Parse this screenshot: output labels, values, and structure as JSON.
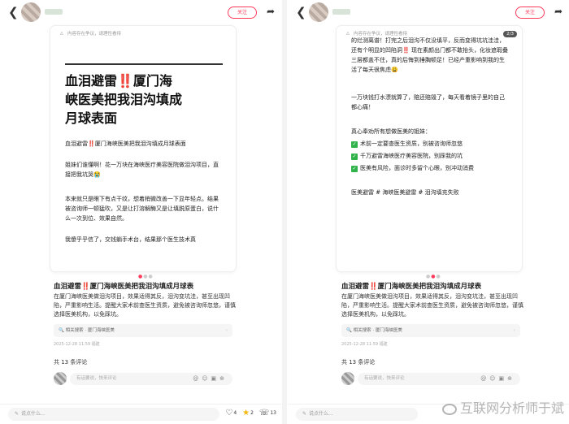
{
  "nav": {
    "back_icon": "chevron-left-icon",
    "follow_label": "关注",
    "share_icon": "share-icon"
  },
  "banner_text": "内容存在争议，请理性看待",
  "left": {
    "card": {
      "title_lines": [
        "血泪避雷‼️厦门海",
        "峡医美把我泪沟填成",
        "月球表面"
      ],
      "subtitle": "血泪避雷‼️厦门海峡医美把我泪沟填成月球表面",
      "p1": "姐妹们谁懂啊！花一万块在海峡医疗美容医院做泪沟项目，直接把我坑哭😭",
      "p2": "本来就只是眼下有点干纹，想着稍微改善一下显年轻点。结果被咨询师一顿猛吹，又是让打溶解酶又是让填脱原蛋白，说什么一次到位、效果自然。",
      "p3": "我傻乎乎信了，交钱躺手术台，结果那个医生技术真"
    },
    "post_title": "血泪避雷‼️厦门海峡医美把我泪沟填成月球表",
    "post_body": "在厦门海峡医美做泪沟项目，效果适得其反，泪沟变坑洼，甚至出现凹陷，严重影响生活。提醒大家术前查医生资质，避免被咨询师忽悠，谨慎选择医美机构，以免踩坑。",
    "related": "相关搜索 · 厦门海峡医美",
    "meta": "2025-12-28 11:59 福建",
    "comments_count": "共 13 条评论",
    "comment_placeholder": "有话要说，快来评论"
  },
  "right": {
    "card": {
      "page_indicator": "2/3",
      "p1": "的烂测离谱！打完之后泪沟不仅没填平，反而变得坑坑洼洼，还有个明显的凹陷洞‼️ 现在素颜出门都不敢抬头，化妆遮瑕叠三层都盖不住，真的后悔到捶胸顿足！已经产重影响到我的生活了每天很焦虑😩",
      "p2": "一万块钱打水漂就算了，赔还赔毁了，每天看着镜子里的自己都心痛！",
      "p3": "真心奉劝所有想做医美的姐妹：",
      "bullets": [
        "术前一定要查医生资质，别被咨询师忽悠",
        "千万避雷海峡医疗美容医院，别踩我的坑",
        "医美有风险，面诊时多留个心眼，别冲动消费"
      ],
      "tags": "医美避雷 # 海峡医美避雷 # 泪沟填充失败"
    },
    "post_title": "血泪避雷‼️厦门海峡医美把我泪沟填成月球表",
    "post_body": "在厦门海峡医美做泪沟项目，效果适得其反，泪沟变坑洼，甚至出现凹陷，严重影响生活。提醒大家术前查医生资质，避免被咨询师忽悠，谨慎选择医美机构，以免踩坑。",
    "related": "相关搜索 · 厦门海峡医美",
    "meta": "2025-12-28 11:59 福建",
    "comments_count": "共 13 条评论",
    "comment_placeholder": "有话要说，快来评论"
  },
  "bottom": {
    "input_placeholder": "说点什么...",
    "likes": "4",
    "stars": "2",
    "comments": "13"
  },
  "watermark": "互联网分析师于斌"
}
